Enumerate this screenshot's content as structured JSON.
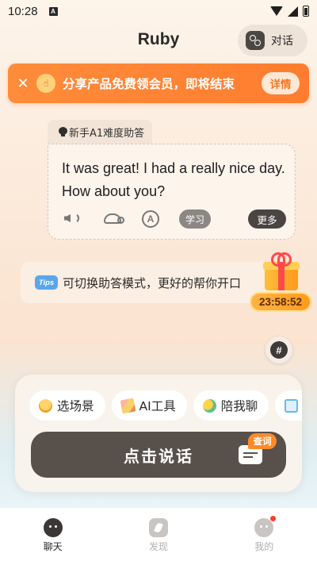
{
  "status_bar": {
    "time": "10:28",
    "notification_icon": "A"
  },
  "header": {
    "title": "Ruby",
    "chat_toggle_label": "对话"
  },
  "banner": {
    "text": "分享产品免费领会员，即将结束",
    "details_label": "详情"
  },
  "answer": {
    "mode_label": "新手A1难度助答",
    "text": "It was great! I had a really nice day. How about you?",
    "translate_icon_glyph": "A",
    "learn_label": "学习",
    "more_label": "更多"
  },
  "tips": {
    "badge": "Tips",
    "text": "可切换助答模式，更好的帮你开口"
  },
  "countdown": "23:58:52",
  "hash_glyph": "#",
  "chips": [
    {
      "label": "选场景",
      "icon": "bulb-icon"
    },
    {
      "label": "AI工具",
      "icon": "pencil-icon"
    },
    {
      "label": "陪我聊",
      "icon": "chat-bubble-icon"
    },
    {
      "label": "",
      "icon": "image-icon"
    }
  ],
  "talk_button_label": "点击说话",
  "dictionary_badge": "查词",
  "nav": [
    {
      "label": "聊天",
      "icon": "chat-face-icon",
      "active": true
    },
    {
      "label": "发现",
      "icon": "discover-icon",
      "active": false
    },
    {
      "label": "我的",
      "icon": "profile-icon",
      "active": false
    }
  ],
  "colors": {
    "accent": "#ff8a2a",
    "dark_button": "#57504b",
    "tips_badge": "#5aa6ea"
  }
}
